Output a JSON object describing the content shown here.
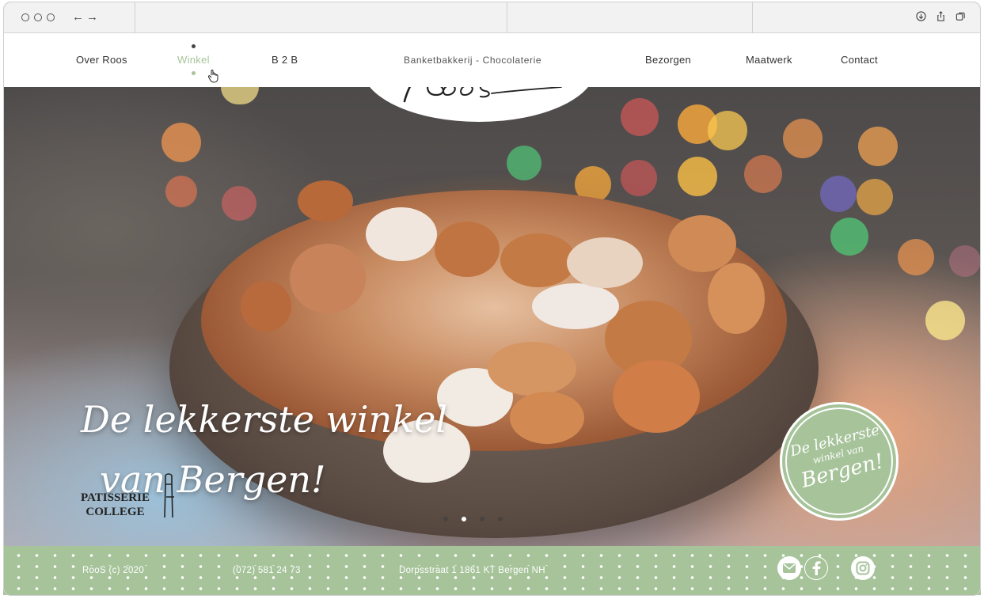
{
  "nav": {
    "left": [
      "Over Roos",
      "Winkel",
      "B 2 B"
    ],
    "right": [
      "Bezorgen",
      "Maatwerk",
      "Contact"
    ],
    "active": "Winkel"
  },
  "brand": {
    "tagline": "Banketbakkerij - Chocolaterie",
    "logo": "Roos"
  },
  "hero": {
    "headline_line1": "De lekkerste winkel",
    "headline_line2": "van Bergen!",
    "badge_line1": "De lekkerste",
    "badge_line2": "winkel van",
    "badge_line3": "Bergen!",
    "partner_logo_line1": "PATISSERIE",
    "partner_logo_line2": "COLLEGE",
    "slide_count": 4,
    "active_slide": 2
  },
  "footer": {
    "copyright": "RooS (c) 2020",
    "phone": "(072) 581 24 73",
    "address": "Dorpsstraat 1 1861 KT Bergen NH",
    "social_icons": [
      "mail-icon",
      "facebook-icon",
      "instagram-icon"
    ]
  },
  "colors": {
    "accent": "#a6c39a",
    "text": "#333333"
  }
}
